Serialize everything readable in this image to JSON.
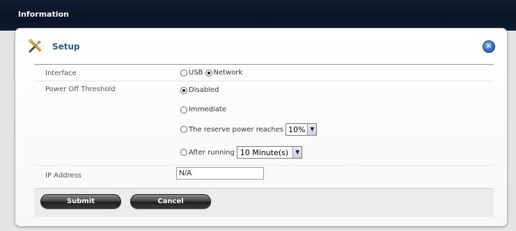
{
  "topbar": {
    "title": "Information"
  },
  "panel": {
    "title": "Setup",
    "icons": {
      "setup": "tools-wrench-screwdriver-icon",
      "close": "close-circle-icon"
    },
    "colors": {
      "title": "#2b5d9a",
      "close_button": "#3a6fbf"
    }
  },
  "form": {
    "interface": {
      "label": "Interface",
      "options": [
        {
          "label": "USB",
          "checked": false
        },
        {
          "label": "Network",
          "checked": true
        }
      ]
    },
    "power_off": {
      "label": "Power Off Threshold",
      "options": [
        {
          "label": "Disabled",
          "checked": true
        },
        {
          "label": "Immediate",
          "checked": false
        },
        {
          "label": "The reserve power reaches",
          "checked": false,
          "select_value": "10%"
        },
        {
          "label": "After running",
          "checked": false,
          "select_value": "10 Minute(s)"
        }
      ]
    },
    "ip": {
      "label": "IP Address",
      "value": "N/A"
    }
  },
  "buttons": {
    "submit": "Submit",
    "cancel": "Cancel"
  }
}
